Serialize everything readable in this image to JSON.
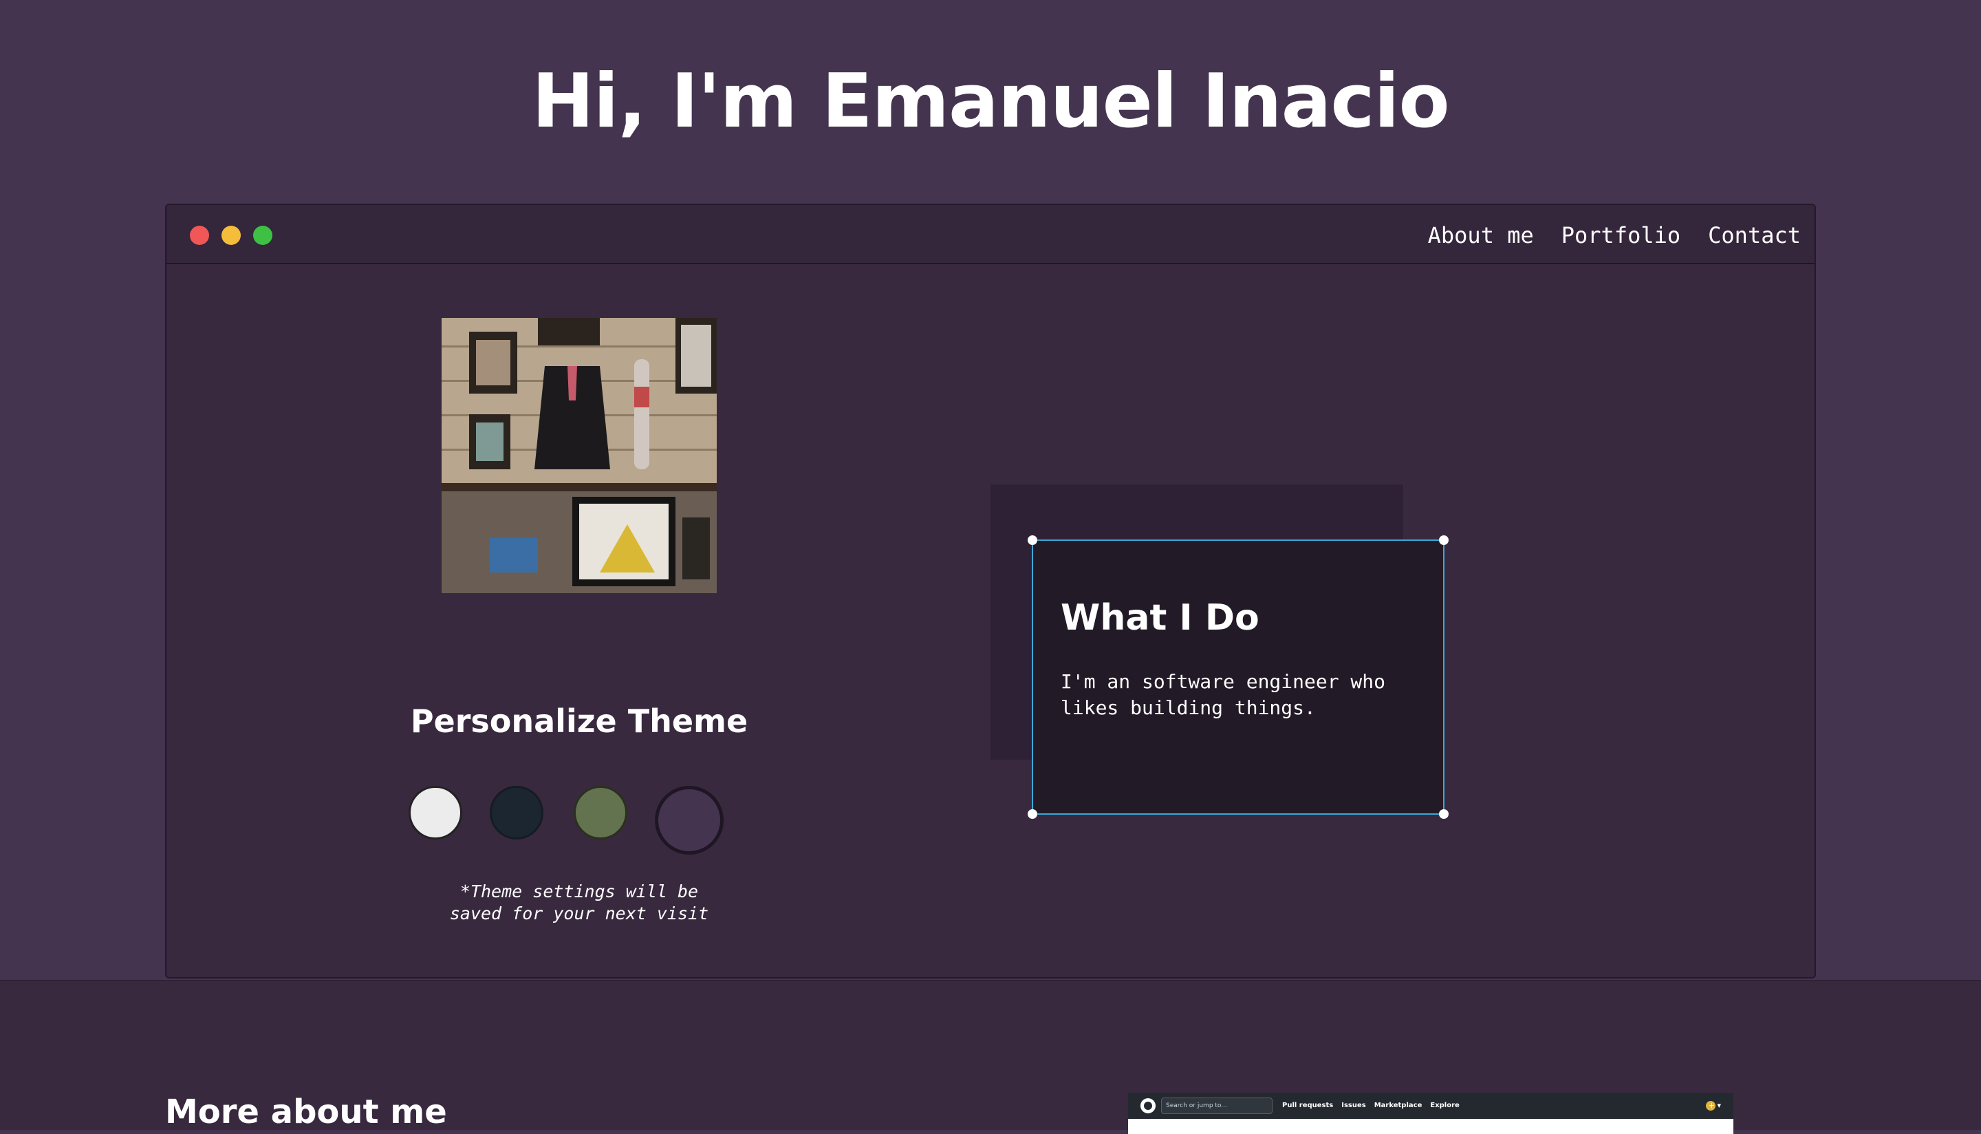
{
  "hero": {
    "title": "Hi, I'm Emanuel Inacio"
  },
  "nav": {
    "items": [
      "About me",
      "Portfolio",
      "Contact"
    ]
  },
  "theme": {
    "title": "Personalize Theme",
    "swatches": [
      {
        "name": "light",
        "color": "#ececec"
      },
      {
        "name": "blue",
        "color": "#1c2630"
      },
      {
        "name": "green",
        "color": "#64734f"
      },
      {
        "name": "purple",
        "color": "#443450",
        "selected": true
      }
    ],
    "note_line1": "*Theme settings will be",
    "note_line2": "saved for your next visit"
  },
  "card": {
    "title": "What I Do",
    "text_line1": "I'm an software engineer who",
    "text_line2": "likes building things."
  },
  "more": {
    "title": "More about me"
  },
  "github_preview": {
    "search_placeholder": "Search or jump to...",
    "nav": [
      "Pull requests",
      "Issues",
      "Marketplace",
      "Explore"
    ],
    "right": "+ ▾"
  },
  "colors": {
    "background": "#443450",
    "window": "#38293f",
    "selection_border": "#39a9d6"
  }
}
